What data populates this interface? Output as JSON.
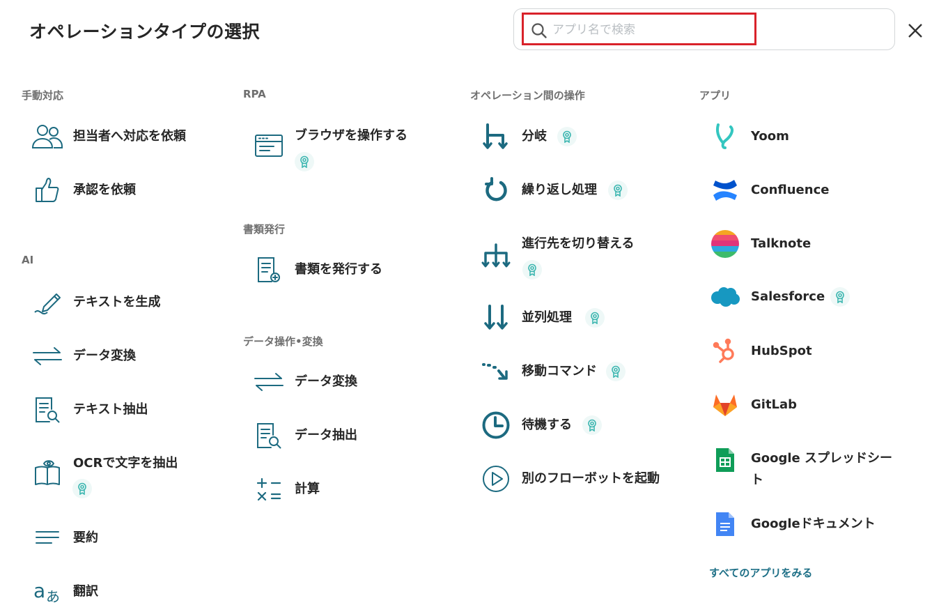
{
  "header": {
    "title": "オペレーションタイプの選択",
    "search_placeholder": "アプリ名で検索"
  },
  "colors": {
    "accent": "#1c6a80",
    "badge": "#3cb6b0",
    "highlight": "#d9222a"
  },
  "sections": {
    "manual": {
      "title": "手動対応",
      "items": [
        "担当者へ対応を依頼",
        "承認を依頼"
      ]
    },
    "ai": {
      "title": "AI",
      "items": [
        "テキストを生成",
        "データ変換",
        "テキスト抽出",
        "OCRで文字を抽出",
        "要約",
        "翻訳"
      ]
    },
    "rpa": {
      "title": "RPA",
      "items": [
        "ブラウザを操作する"
      ]
    },
    "docs": {
      "title": "書類発行",
      "items": [
        "書類を発行する"
      ]
    },
    "dataops": {
      "title": "データ操作•変換",
      "items": [
        "データ変換",
        "データ抽出",
        "計算"
      ]
    },
    "flow": {
      "title": "オペレーション間の操作",
      "items": [
        "分岐",
        "繰り返し処理",
        "進行先を切り替える",
        "並列処理",
        "移動コマンド",
        "待機する",
        "別のフローボットを起動"
      ]
    },
    "apps": {
      "title": "アプリ",
      "items": [
        "Yoom",
        "Confluence",
        "Talknote",
        "Salesforce",
        "HubSpot",
        "GitLab",
        "Google スプレッドシート",
        "Googleドキュメント"
      ],
      "more": "すべてのアプリをみる"
    }
  }
}
